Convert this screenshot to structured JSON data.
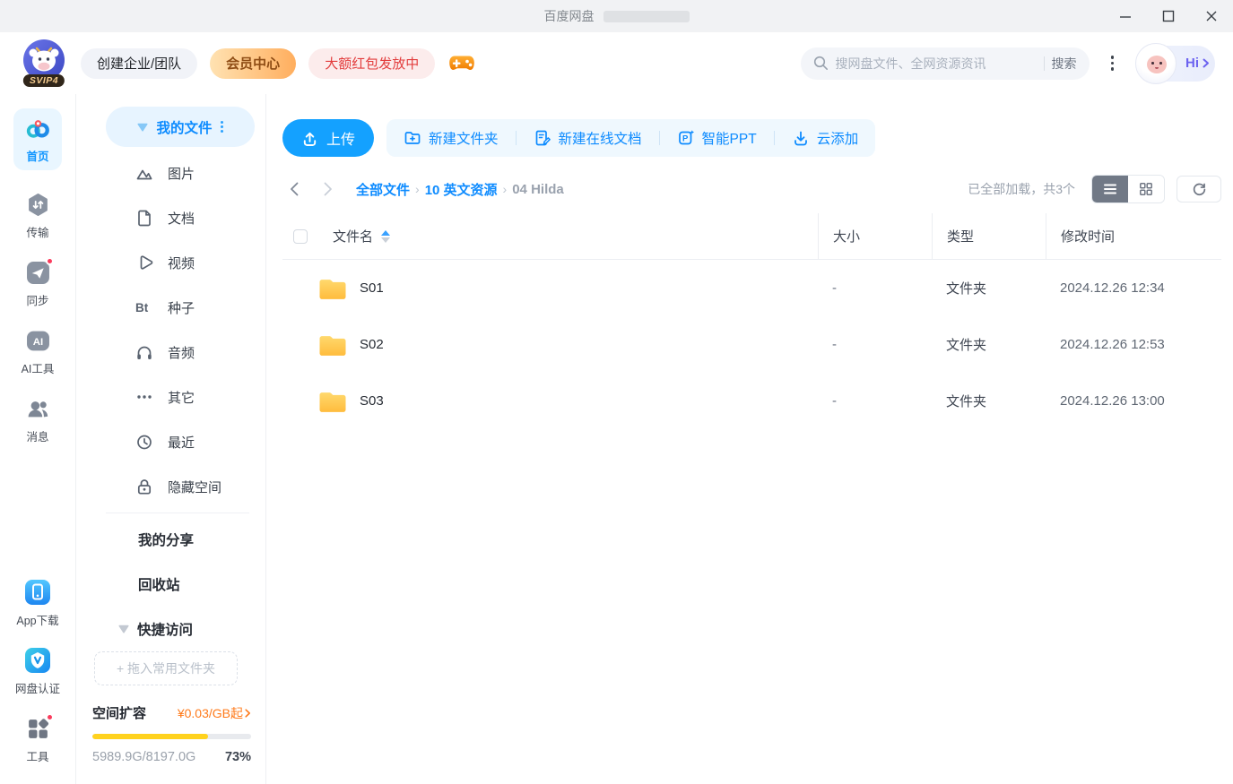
{
  "titlebar": {
    "app_title": "百度网盘"
  },
  "header": {
    "svip_badge": "SVIP4",
    "create_team_label": "创建企业/团队",
    "member_center_label": "会员中心",
    "red_packet_label": "大额红包发放中",
    "search": {
      "placeholder": "搜网盘文件、全网资源资讯",
      "button_label": "搜索"
    },
    "greeting_label": "Hi"
  },
  "rail": {
    "items_top": [
      {
        "label": "首页"
      },
      {
        "label": "传输"
      },
      {
        "label": "同步"
      },
      {
        "label": "AI工具"
      },
      {
        "label": "消息"
      }
    ],
    "items_bottom": [
      {
        "label": "App下载"
      },
      {
        "label": "网盘认证"
      },
      {
        "label": "工具"
      }
    ]
  },
  "sidebar": {
    "my_files_label": "我的文件",
    "bt_icon_text": "Bt",
    "categories": [
      {
        "label": "图片"
      },
      {
        "label": "文档"
      },
      {
        "label": "视频"
      },
      {
        "label": "种子"
      },
      {
        "label": "音频"
      },
      {
        "label": "其它"
      },
      {
        "label": "最近"
      },
      {
        "label": "隐藏空间"
      }
    ],
    "my_share_label": "我的分享",
    "recycle_label": "回收站",
    "quick_access_label": "快捷访问",
    "drop_hint": "+ 拖入常用文件夹",
    "storage": {
      "expand_label": "空间扩容",
      "price_label": "¥0.03/GB起",
      "usage": "5989.9G/8197.0G",
      "percent": "73%"
    }
  },
  "main": {
    "toolbar": {
      "upload_label": "上传",
      "new_folder_label": "新建文件夹",
      "new_doc_label": "新建在线文档",
      "smart_ppt_label": "智能PPT",
      "cloud_add_label": "云添加"
    },
    "breadcrumb": {
      "root": "全部文件",
      "parent": "10 英文资源",
      "current": "04 Hilda",
      "separator": "›"
    },
    "status_text": "已全部加载，共3个",
    "table": {
      "col_name": "文件名",
      "col_size": "大小",
      "col_type": "类型",
      "col_modified": "修改时间",
      "files": [
        {
          "name": "S01",
          "size": "-",
          "type": "文件夹",
          "modified": "2024.12.26 12:34"
        },
        {
          "name": "S02",
          "size": "-",
          "type": "文件夹",
          "modified": "2024.12.26 12:53"
        },
        {
          "name": "S03",
          "size": "-",
          "type": "文件夹",
          "modified": "2024.12.26 13:00"
        }
      ]
    }
  },
  "colors": {
    "accent_blue": "#14a1ff",
    "link_blue": "#0d8bff",
    "vip_orange": "#ff7a1a",
    "progress_yellow": "#ffd21e",
    "red_badge": "#e23c3c"
  }
}
